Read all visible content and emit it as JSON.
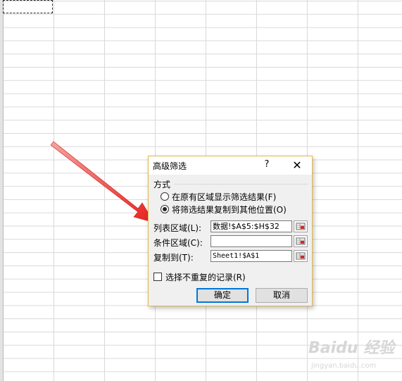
{
  "dialog": {
    "title": "高级筛选",
    "help": "?",
    "close": "✕",
    "group_label": "方式",
    "radio_options": [
      {
        "label": "在原有区域显示筛选结果(F)",
        "checked": false
      },
      {
        "label": "将筛选结果复制到其他位置(O)",
        "checked": true
      }
    ],
    "fields": [
      {
        "label": "列表区域(L):",
        "value": "数据!$A$5:$H$32"
      },
      {
        "label": "条件区域(C):",
        "value": ""
      },
      {
        "label": "复制到(T):",
        "value": "Sheet1!$A$1"
      }
    ],
    "unique_label": "选择不重复的记录(R)",
    "unique_checked": false,
    "ok": "确定",
    "cancel": "取消"
  },
  "annotation": {
    "arrow_color": "#e8211d"
  },
  "watermark": {
    "text": "Baidu 经验",
    "sub": "jingyan.baidu.com"
  },
  "colors": {
    "dialog_border": "#e0b84c",
    "default_button": "#0078d7"
  }
}
